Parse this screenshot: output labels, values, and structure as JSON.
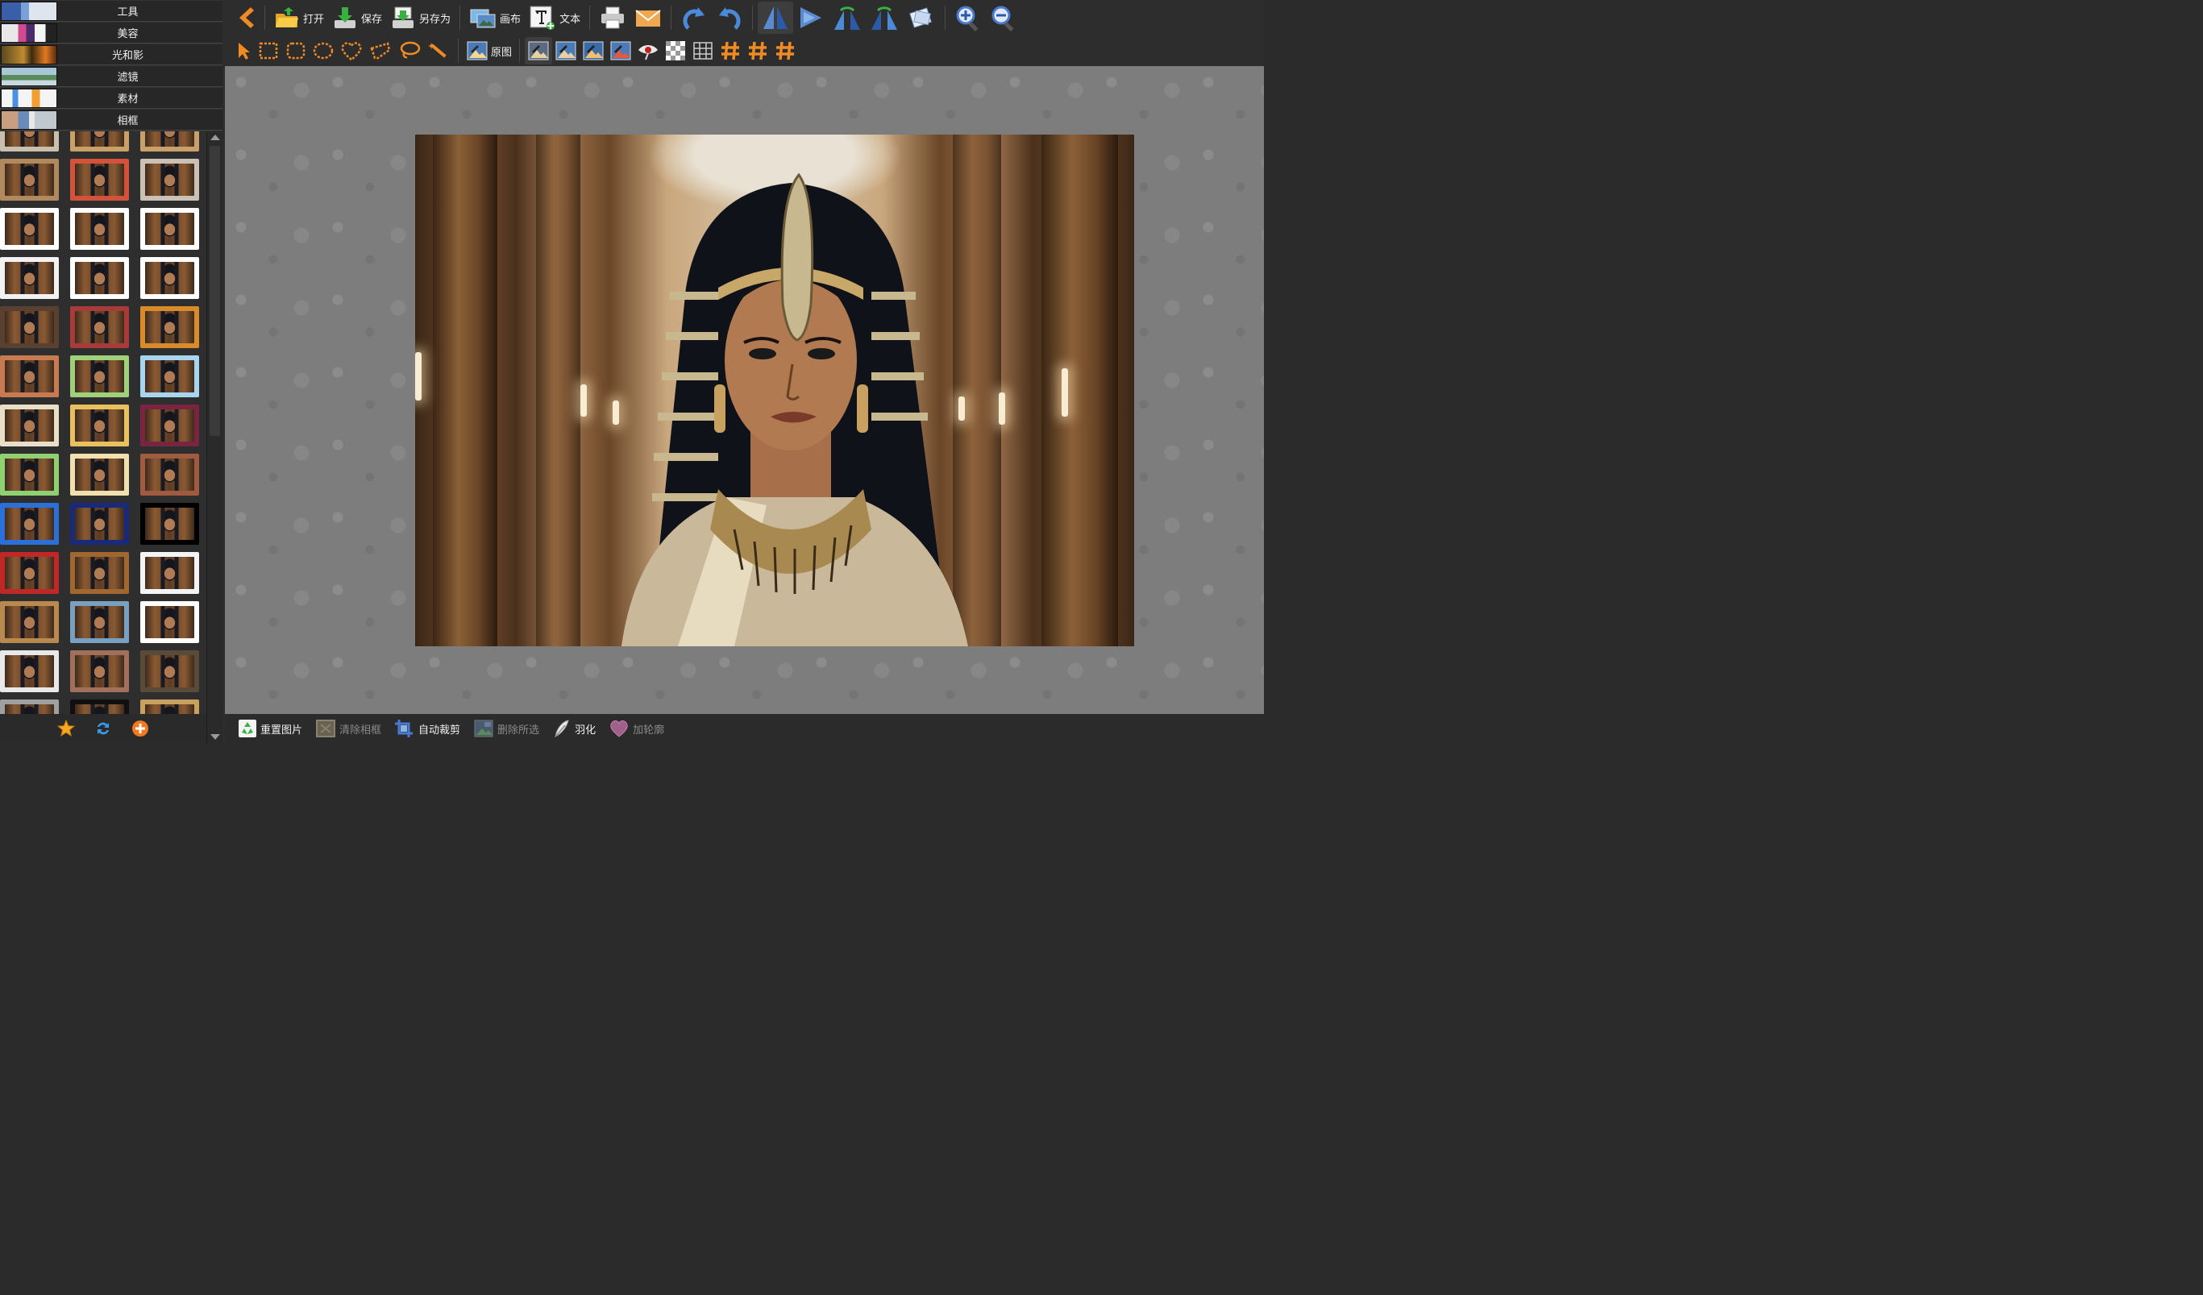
{
  "categories": [
    {
      "label": "工具"
    },
    {
      "label": "美容"
    },
    {
      "label": "光和影"
    },
    {
      "label": "滤镜"
    },
    {
      "label": "素材"
    },
    {
      "label": "相框"
    }
  ],
  "toolbar_main": {
    "back_icon": "back-arrow-icon",
    "open_label": "打开",
    "save_label": "保存",
    "save_as_label": "另存为",
    "canvas_label": "画布",
    "text_label": "文本"
  },
  "toolbar_secondary": {
    "original_label": "原图"
  },
  "bottom_bar": {
    "reset_label": "重置图片",
    "clear_frame_label": "清除相框",
    "auto_crop_label": "自动裁剪",
    "delete_selection_label": "删除所选",
    "feather_label": "羽化",
    "outline_label": "加轮廓"
  },
  "colors": {
    "accent_orange": "#f08a24",
    "toolbar_bg": "#2d2d2d",
    "canvas_bg": "#7d7d7d",
    "icon_blue": "#4a7fd0"
  },
  "frame_styles": [
    [
      "#c8bfae",
      "#c8a068",
      "#c7a06c"
    ],
    [
      "#b08a5e",
      "#d2523a",
      "#c9c1b5"
    ],
    [
      "#ffffff",
      "#ffffff",
      "#ffffff"
    ],
    [
      "#f2f2f2",
      "#ffffff",
      "#ffffff"
    ],
    [
      "#5a4030",
      "#a83a3a",
      "#d98a2a"
    ],
    [
      "#c87a50",
      "#9fd07a",
      "#a8d4f0"
    ],
    [
      "#e8dfc8",
      "#e8c060",
      "#7a2440"
    ],
    [
      "#8fd070",
      "#f0e0b0",
      "#a05a40"
    ],
    [
      "#2a70d8",
      "#1a2a7a",
      "#000000"
    ],
    [
      "#c02828",
      "#a06830",
      "#f4f4f4"
    ],
    [
      "#b88a50",
      "#7aa0c0",
      "#ffffff"
    ],
    [
      "#e8e8e8",
      "#a0705a",
      "#5a4a3a"
    ],
    [
      "#a0a0a0",
      "#101010",
      "#c8a060"
    ]
  ]
}
